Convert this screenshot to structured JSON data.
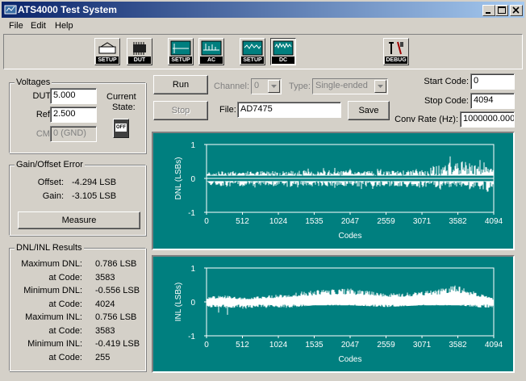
{
  "window": {
    "title": "ATS4000 Test System",
    "controls": [
      "_",
      "□",
      "×"
    ]
  },
  "menu": [
    "File",
    "Edit",
    "Help"
  ],
  "toolbar": [
    {
      "name": "toolbar-setup-button",
      "label": "SETUP",
      "icon": "setup-icon"
    },
    {
      "name": "toolbar-dut-button",
      "label": "DUT",
      "icon": "dut-chip-icon"
    },
    {
      "name": "toolbar-ac-setup-button",
      "label": "SETUP",
      "icon": "ac-setup-icon"
    },
    {
      "name": "toolbar-ac-button",
      "label": "AC",
      "icon": "ac-icon"
    },
    {
      "name": "toolbar-dc-setup-button",
      "label": "SETUP",
      "icon": "dc-setup-icon"
    },
    {
      "name": "toolbar-dc-button",
      "label": "DC",
      "icon": "dc-icon"
    },
    {
      "name": "toolbar-debug-button",
      "label": "DEBUG",
      "icon": "debug-tools-icon"
    }
  ],
  "voltages": {
    "title": "Voltages",
    "dut_label": "DUT:",
    "dut_value": "5.000",
    "ref_label": "Ref:",
    "ref_value": "2.500",
    "cm_label": "CM:",
    "cm_value": "0 (GND)",
    "state_label_1": "Current",
    "state_label_2": "State:",
    "state_switch": "OFF"
  },
  "gain_offset": {
    "title": "Gain/Offset Error",
    "offset_label": "Offset:",
    "offset_value": "-4.294 LSB",
    "gain_label": "Gain:",
    "gain_value": "-3.105 LSB",
    "measure_label": "Measure"
  },
  "results": {
    "title": "DNL/INL Results",
    "rows": [
      {
        "label": "Maximum DNL:",
        "value": "0.786 LSB"
      },
      {
        "label": "at Code:",
        "value": "3583"
      },
      {
        "label": "Minimum DNL:",
        "value": "-0.556 LSB"
      },
      {
        "label": "at Code:",
        "value": "4024"
      },
      {
        "label": "Maximum INL:",
        "value": "0.756 LSB"
      },
      {
        "label": "at Code:",
        "value": "3583"
      },
      {
        "label": "Minimum INL:",
        "value": "-0.419 LSB"
      },
      {
        "label": "at Code:",
        "value": "255"
      }
    ]
  },
  "controls": {
    "run_label": "Run",
    "stop_label": "Stop",
    "channel_label": "Channel:",
    "channel_value": "0",
    "type_label": "Type:",
    "type_value": "Single-ended",
    "file_label": "File:",
    "file_value": "AD7475",
    "save_label": "Save",
    "start_code_label": "Start Code:",
    "start_code_value": "0",
    "stop_code_label": "Stop Code:",
    "stop_code_value": "4094",
    "conv_rate_label": "Conv Rate (Hz):",
    "conv_rate_value": "1000000.000"
  },
  "colors": {
    "plot_bg": "#007f7f",
    "trace": "#ffffff"
  },
  "chart_data": [
    {
      "type": "line",
      "ylabel": "DNL (LSBs)",
      "xlabel": "Codes",
      "xlim": [
        0,
        4094
      ],
      "ylim": [
        -1,
        1
      ],
      "xticks": [
        "0",
        "512",
        "1024",
        "1535",
        "2047",
        "2559",
        "3071",
        "3582",
        "4094"
      ],
      "yticks": [
        "1",
        "0",
        "-1"
      ],
      "series": [
        {
          "x": [
            0,
            255,
            512,
            1024,
            1535,
            2047,
            2559,
            3071,
            3583,
            4024,
            4094
          ],
          "envelope_top": [
            0.22,
            0.3,
            0.28,
            0.3,
            0.3,
            0.33,
            0.3,
            0.33,
            0.786,
            0.45,
            0.4
          ],
          "envelope_bottom": [
            -0.22,
            -0.35,
            -0.3,
            -0.3,
            -0.3,
            -0.33,
            -0.3,
            -0.35,
            -0.35,
            -0.556,
            -0.4
          ]
        }
      ]
    },
    {
      "type": "line",
      "ylabel": "INL (LSBs)",
      "xlabel": "Codes",
      "xlim": [
        0,
        4094
      ],
      "ylim": [
        -1,
        1
      ],
      "xticks": [
        "0",
        "512",
        "1024",
        "1535",
        "2047",
        "2559",
        "3071",
        "3582",
        "4094"
      ],
      "yticks": [
        "1",
        "0",
        "-1"
      ],
      "series": [
        {
          "x": [
            0,
            255,
            512,
            1024,
            1535,
            2047,
            2559,
            3071,
            3583,
            4094
          ],
          "values": [
            0.15,
            0.2,
            0.12,
            0.22,
            0.35,
            0.4,
            0.25,
            0.3,
            0.5,
            0.1
          ],
          "min": [
            -0.1,
            -0.419,
            -0.2,
            -0.2,
            -0.1,
            -0.1,
            -0.15,
            -0.1,
            -0.1,
            -0.2
          ]
        }
      ]
    }
  ]
}
